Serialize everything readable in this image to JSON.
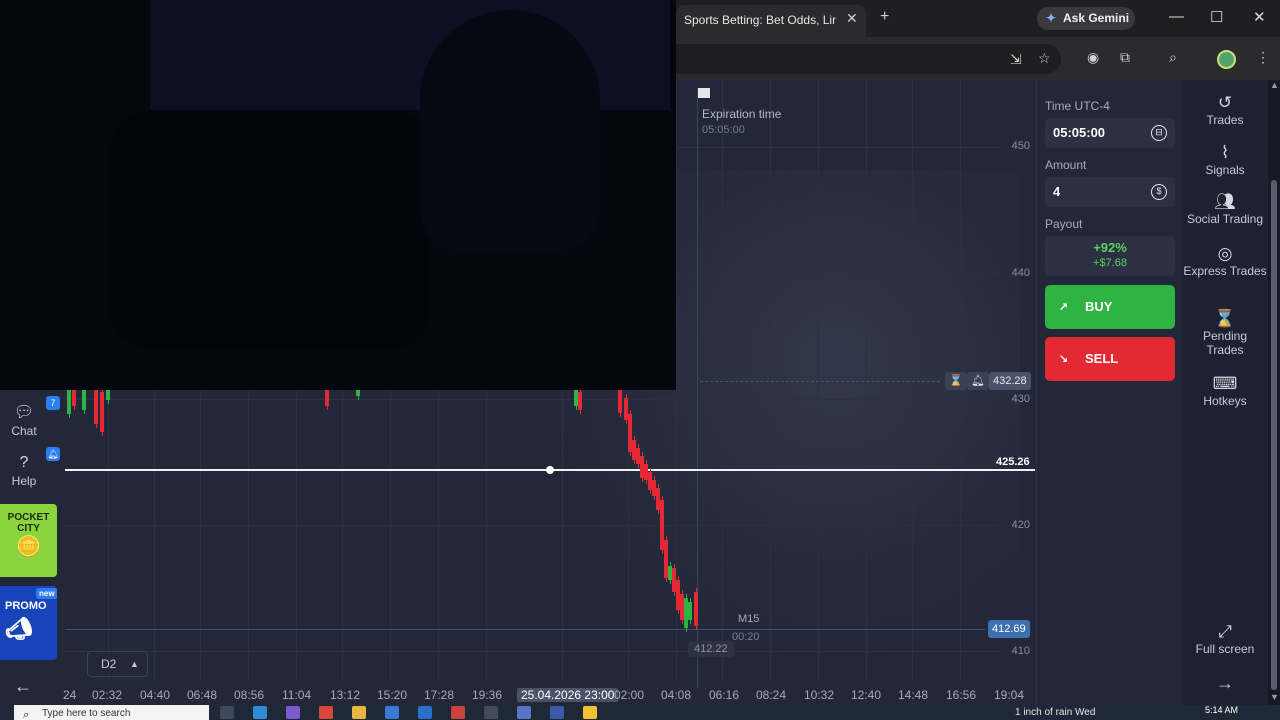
{
  "browser": {
    "tab_title": "Sports Betting: Bet Odds, Lines",
    "close": "✕",
    "new_tab": "+",
    "gemini_label": "Ask Gemini",
    "minimize": "—",
    "maximize": "☐",
    "close_window": "✕"
  },
  "chart": {
    "expiration_label": "Expiration time",
    "expiration_time": "05:05:00",
    "price_labels": [
      "450",
      "440",
      "430",
      "420",
      "410"
    ],
    "time_labels": [
      "24",
      "02:32",
      "04:40",
      "06:48",
      "08:56",
      "11:04",
      "13:12",
      "15:20",
      "17:28",
      "19:36",
      "25.04.2026 23:00",
      "02:00",
      "04:08",
      "06:16",
      "08:24",
      "10:32",
      "12:40",
      "14:48",
      "16:56",
      "19:04"
    ],
    "dashed_price": "432.28",
    "line_price": "425.26",
    "current_price": "412.69",
    "low_price": "412.22",
    "timeframe": "M15",
    "countdown": "00:20",
    "period_select": "D2",
    "colors": {
      "up": "#2fb444",
      "down": "#e32a34",
      "current_tag": "#3e6fb1"
    }
  },
  "left_rail": {
    "chat_label": "Chat",
    "chat_badge": "7",
    "help_label": "Help",
    "pocket_city": "POCKET CITY",
    "promo_label": "PROMO",
    "promo_badge": "new",
    "back_arrow": "←"
  },
  "trade_panel": {
    "time_label": "Time UTC-4",
    "time_value": "05:05:00",
    "amount_label": "Amount",
    "amount_value": "4",
    "payout_label": "Payout",
    "payout_percent": "+92%",
    "payout_amount": "+$7.68",
    "buy_label": "BUY",
    "sell_label": "SELL"
  },
  "side_menu": {
    "items": [
      {
        "label": "Trades",
        "icon": "history-icon"
      },
      {
        "label": "Signals",
        "icon": "signal-icon"
      },
      {
        "label": "Social Trading",
        "icon": "people-icon"
      },
      {
        "label": "Express Trades",
        "icon": "target-icon"
      },
      {
        "label": "Pending Trades",
        "icon": "hourglass-icon"
      },
      {
        "label": "Hotkeys",
        "icon": "keyboard-icon"
      }
    ],
    "fullscreen_label": "Full screen",
    "forward_arrow": "→"
  },
  "taskbar": {
    "search_placeholder": "Type here to search",
    "weather": "1 inch of rain Wed",
    "clock": "5:14 AM"
  }
}
